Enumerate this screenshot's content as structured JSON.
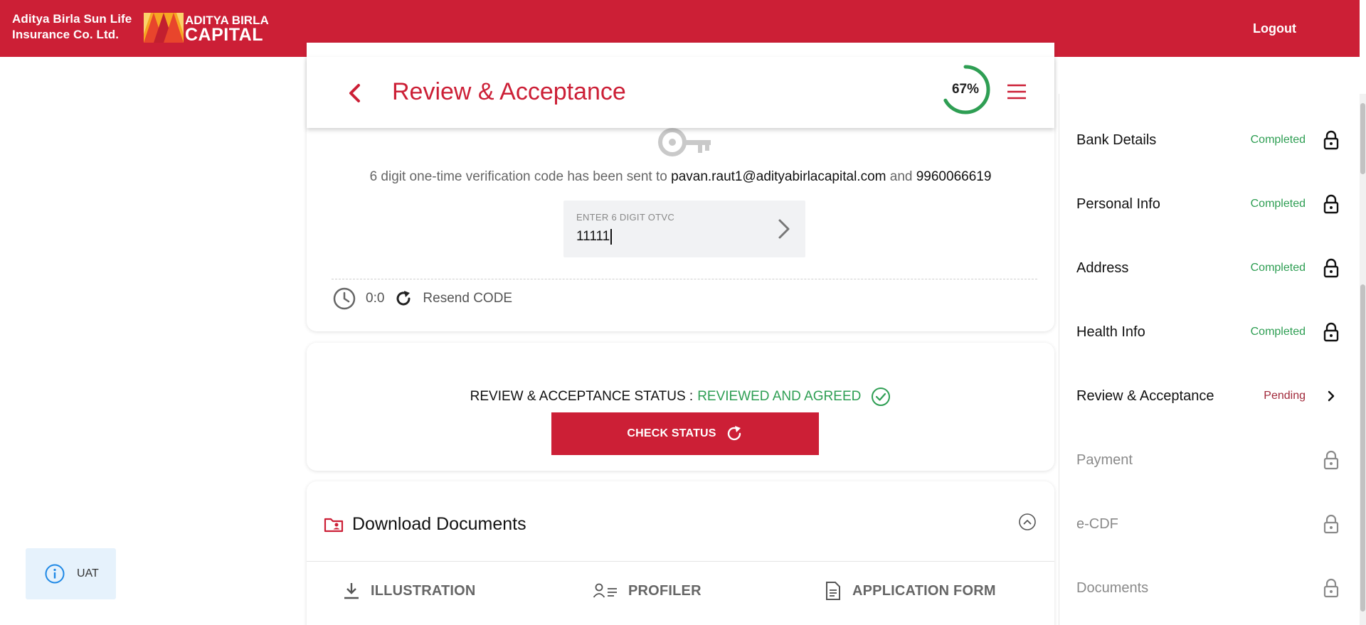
{
  "header": {
    "brand_line1": "Aditya Birla Sun Life",
    "brand_line2": "Insurance Co. Ltd.",
    "logo_line1": "ADITYA BIRLA",
    "logo_line2": "CAPITAL",
    "logout_label": "Logout",
    "bg_color": "#cc1f36"
  },
  "title_bar": {
    "title": "Review & Acceptance",
    "progress_label": "67%",
    "progress_value": 0.67,
    "progress_color": "#2e9e53"
  },
  "otp": {
    "message_prefix": "6 digit one-time verification code has been sent to",
    "email": "pavan.raut1@adityabirlacapital.com",
    "conjunction": "and",
    "phone": "9960066619",
    "input_label": "ENTER 6 DIGIT OTVC",
    "input_value": "11111",
    "timer": "0:0",
    "resend_label": "Resend CODE"
  },
  "status": {
    "label": "REVIEW & ACCEPTANCE STATUS :",
    "value": "REVIEWED AND AGREED",
    "button_label": "CHECK STATUS"
  },
  "documents": {
    "title": "Download Documents",
    "links": [
      "ILLUSTRATION",
      "PROFILER",
      "APPLICATION FORM"
    ]
  },
  "uat_badge": "UAT",
  "steps": [
    {
      "label": "Bank Details",
      "status": "Completed",
      "icon": "lock-icon"
    },
    {
      "label": "Personal Info",
      "status": "Completed",
      "icon": "lock-icon"
    },
    {
      "label": "Address",
      "status": "Completed",
      "icon": "lock-icon"
    },
    {
      "label": "Health Info",
      "status": "Completed",
      "icon": "lock-icon"
    },
    {
      "label": "Review & Acceptance",
      "status": "Pending",
      "icon": "chevron-right-icon"
    },
    {
      "label": "Payment",
      "status": "",
      "icon": "lock-icon"
    },
    {
      "label": "e-CDF",
      "status": "",
      "icon": "lock-icon"
    },
    {
      "label": "Documents",
      "status": "",
      "icon": "lock-icon"
    }
  ]
}
